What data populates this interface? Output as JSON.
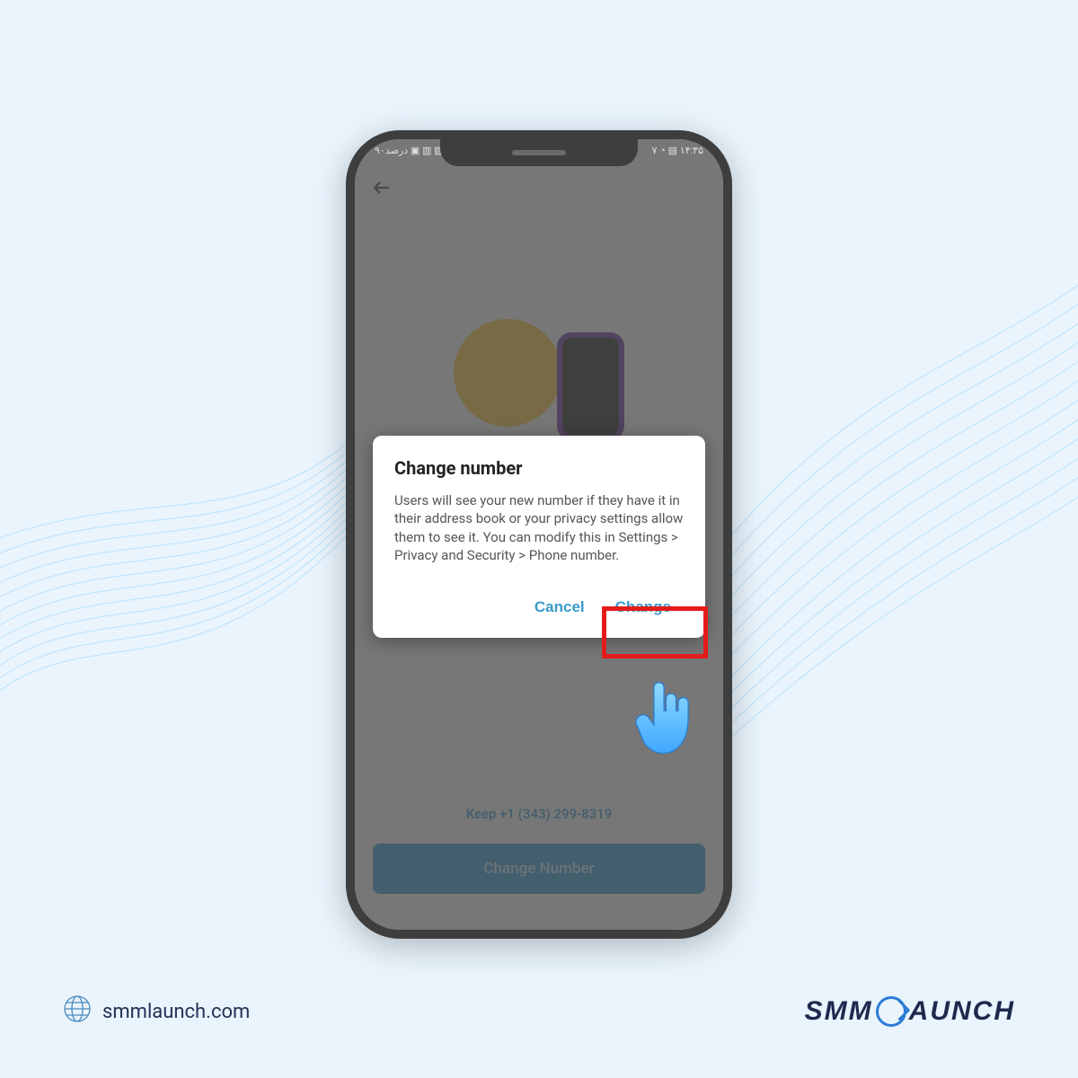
{
  "status_bar": {
    "left": "۹۰درصد ▣ ▥ ▧ ◈",
    "right": "۷ ◔ ▤ ۱۴:۳۵"
  },
  "screen": {
    "keep_link": "Keep +1 (343) 299-8319",
    "change_button": "Change Number"
  },
  "dialog": {
    "title": "Change number",
    "body": "Users will see your new number if they have it in their address book or your privacy settings allow them to see it. You can modify this in Settings > Privacy and Security > Phone number.",
    "cancel": "Cancel",
    "confirm": "Change"
  },
  "footer": {
    "url": "smmlaunch.com",
    "brand_left": "SMM",
    "brand_right": "AUNCH"
  }
}
